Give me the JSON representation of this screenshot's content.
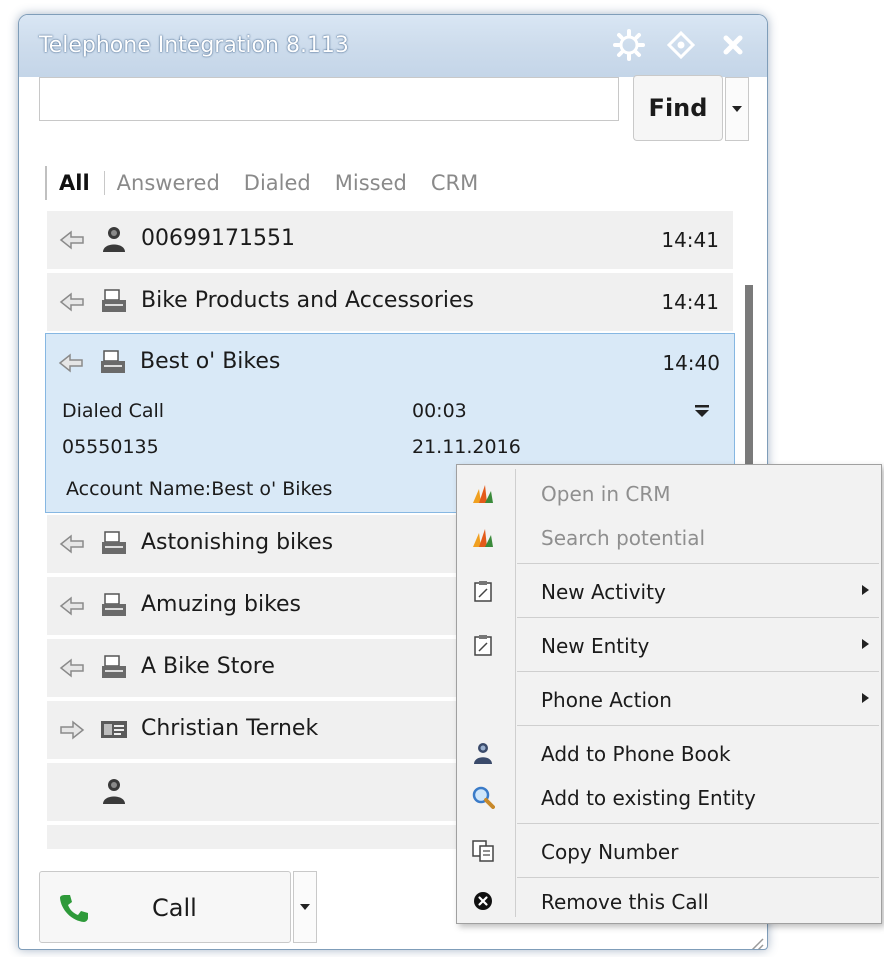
{
  "window": {
    "title": "Telephone Integration 8.113",
    "icons": [
      "settings-icon",
      "pin-icon",
      "close-icon"
    ]
  },
  "search": {
    "value": "",
    "placeholder": "",
    "find_label": "Find"
  },
  "tabs": [
    {
      "label": "All",
      "active": true
    },
    {
      "label": "Answered",
      "active": false
    },
    {
      "label": "Dialed",
      "active": false
    },
    {
      "label": "Missed",
      "active": false
    },
    {
      "label": "CRM",
      "active": false
    }
  ],
  "calls": [
    {
      "direction": "incoming",
      "type_icon": "contact-person-icon",
      "name": "00699171551",
      "time": "14:41"
    },
    {
      "direction": "incoming",
      "type_icon": "account-icon",
      "name": "Bike Products and Accessories",
      "time": "14:41"
    },
    {
      "direction": "incoming",
      "type_icon": "account-icon",
      "name": "Best o' Bikes",
      "time": "14:40",
      "selected": true,
      "details": {
        "call_type": "Dialed Call",
        "duration": "00:03",
        "number": "05550135",
        "date": "21.11.2016",
        "account": "Account Name:Best o' Bikes"
      }
    },
    {
      "direction": "incoming",
      "type_icon": "account-icon",
      "name": "Astonishing bikes",
      "time": ""
    },
    {
      "direction": "incoming",
      "type_icon": "account-icon",
      "name": "Amuzing bikes",
      "time": ""
    },
    {
      "direction": "incoming",
      "type_icon": "account-icon",
      "name": "A Bike Store",
      "time": ""
    },
    {
      "direction": "outgoing",
      "type_icon": "contact-card-icon",
      "name": "Christian Ternek",
      "time": ""
    },
    {
      "direction": "none",
      "type_icon": "contact-person-icon",
      "name": "",
      "time": ""
    }
  ],
  "call_button": {
    "label": "Call",
    "icon": "phone-icon"
  },
  "context_menu": {
    "items": [
      {
        "label": "Open in CRM",
        "icon": "dynamics-crm-icon",
        "disabled": true,
        "submenu": false
      },
      {
        "label": "Search potential",
        "icon": "dynamics-crm-icon",
        "disabled": true,
        "submenu": false
      },
      {
        "label": "New Activity",
        "icon": "clipboard-icon",
        "disabled": false,
        "submenu": true
      },
      {
        "label": "New Entity",
        "icon": "clipboard-icon",
        "disabled": false,
        "submenu": true
      },
      {
        "label": "Phone Action",
        "icon": "",
        "disabled": false,
        "submenu": true
      },
      {
        "label": "Add to Phone Book",
        "icon": "contact-person-icon",
        "disabled": false,
        "submenu": false
      },
      {
        "label": "Add to existing Entity",
        "icon": "magnifier-icon",
        "disabled": false,
        "submenu": false
      },
      {
        "label": "Copy Number",
        "icon": "copy-icon",
        "disabled": false,
        "submenu": false
      },
      {
        "label": "Remove this Call",
        "icon": "remove-circle-icon",
        "disabled": false,
        "submenu": false
      }
    ]
  },
  "colors": {
    "selected_row": "#d9e9f7",
    "selected_border": "#86b7e2",
    "row": "#f0f0f0",
    "menu_bg": "#f2f2f2",
    "title_text": "#ffffff",
    "call_icon": "#2e9a3a"
  }
}
